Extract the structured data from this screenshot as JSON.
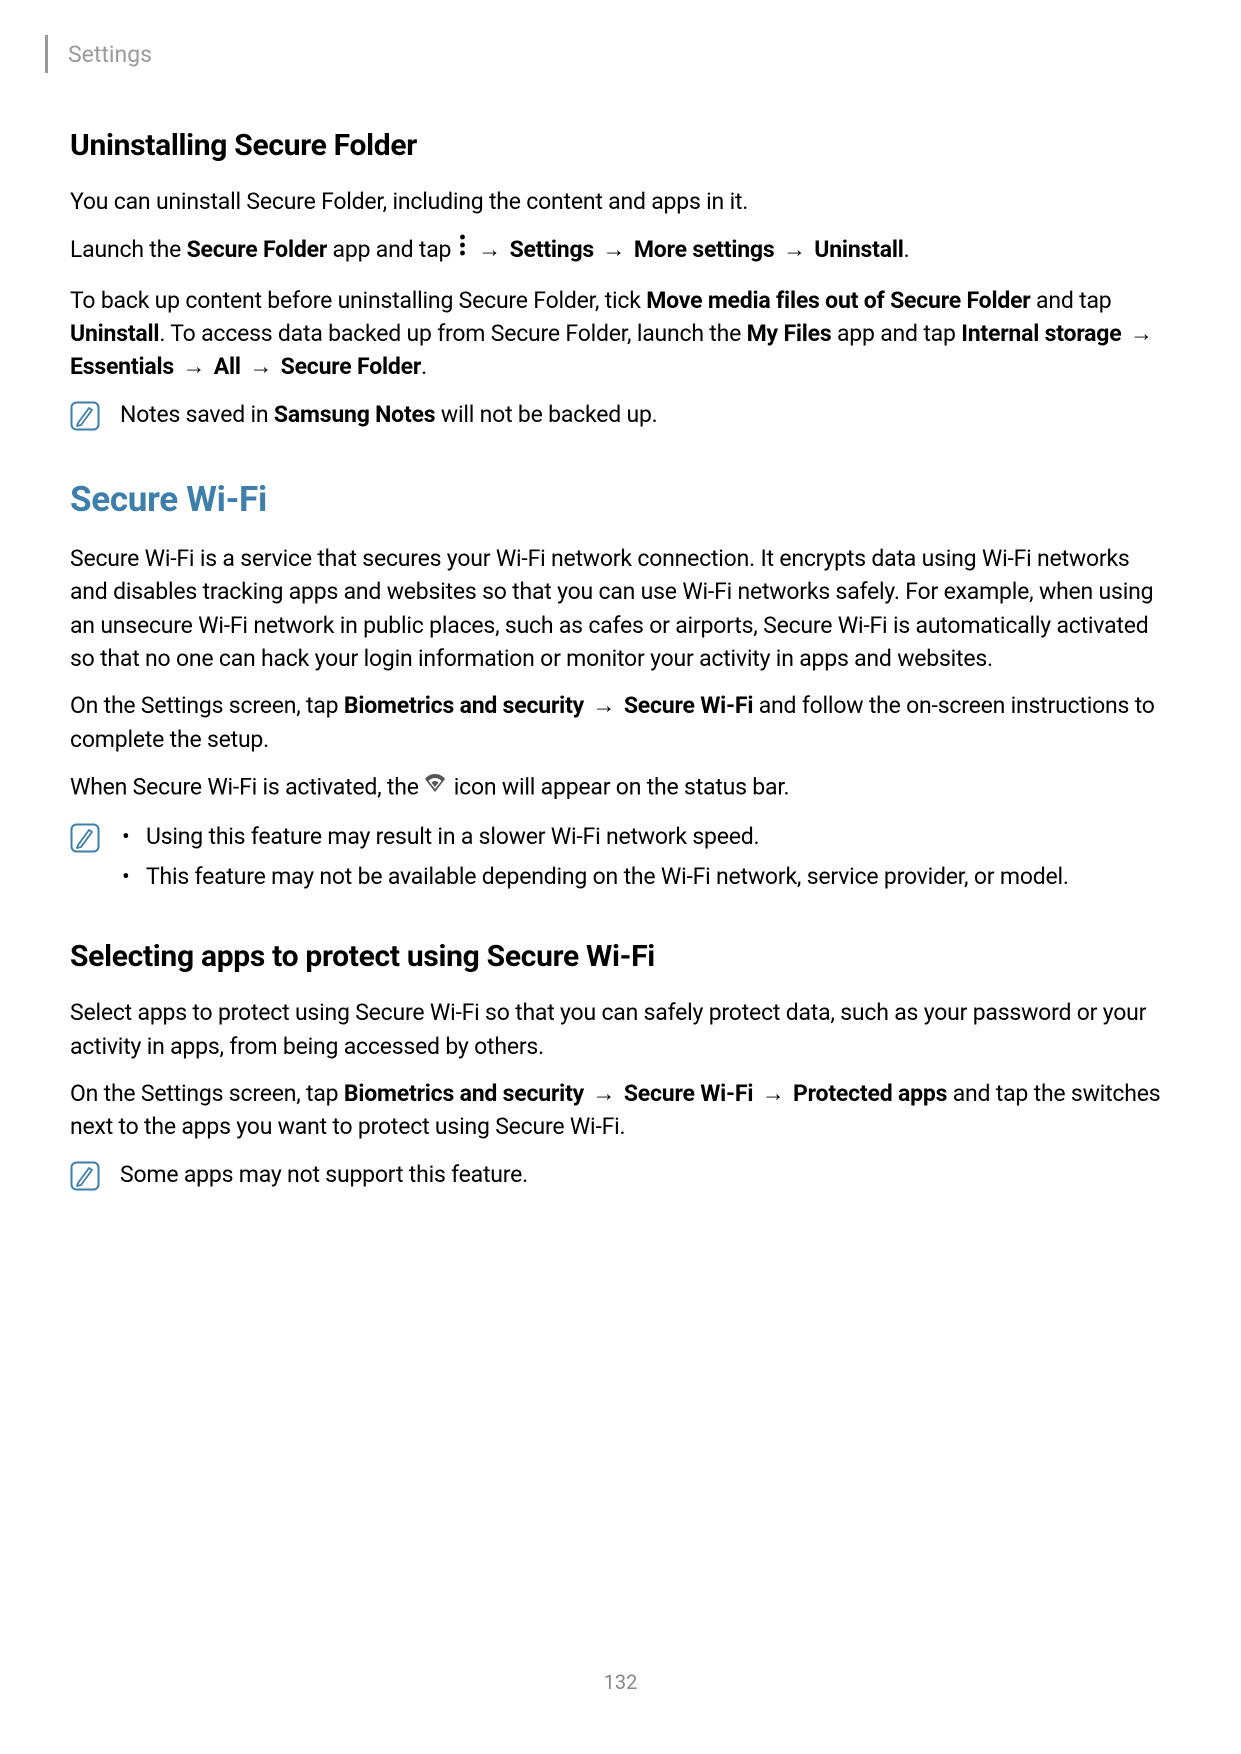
{
  "header": {
    "title": "Settings"
  },
  "pageNumber": "132",
  "uninstall": {
    "heading": "Uninstalling Secure Folder",
    "p1": "You can uninstall Secure Folder, including the content and apps in it.",
    "p2a": "Launch the ",
    "p2b": "Secure Folder",
    "p2c": " app and tap ",
    "p2d": " → ",
    "p2e": "Settings",
    "p2f": " → ",
    "p2g": "More settings",
    "p2h": " → ",
    "p2i": "Uninstall",
    "p2j": ".",
    "p3a": "To back up content before uninstalling Secure Folder, tick ",
    "p3b": "Move media files out of Secure Folder",
    "p3c": " and tap ",
    "p3d": "Uninstall",
    "p3e": ". To access data backed up from Secure Folder, launch the ",
    "p3f": "My Files",
    "p3g": " app and tap ",
    "p3h": "Internal storage",
    "p3i": " → ",
    "p3j": "Essentials",
    "p3k": " → ",
    "p3l": "All",
    "p3m": " → ",
    "p3n": "Secure Folder",
    "p3o": ".",
    "note_a": "Notes saved in ",
    "note_b": "Samsung Notes",
    "note_c": " will not be backed up."
  },
  "secureWifi": {
    "heading": "Secure Wi-Fi",
    "p1": "Secure Wi-Fi is a service that secures your Wi-Fi network connection. It encrypts data using Wi-Fi networks and disables tracking apps and websites so that you can use Wi-Fi networks safely. For example, when using an unsecure Wi-Fi network in public places, such as cafes or airports, Secure Wi-Fi is automatically activated so that no one can hack your login information or monitor your activity in apps and websites.",
    "p2a": "On the Settings screen, tap ",
    "p2b": "Biometrics and security",
    "p2c": " → ",
    "p2d": "Secure Wi-Fi",
    "p2e": " and follow the on-screen instructions to complete the setup.",
    "p3a": "When Secure Wi-Fi is activated, the ",
    "p3b": " icon will appear on the status bar.",
    "bullet1": "Using this feature may result in a slower Wi-Fi network speed.",
    "bullet2": "This feature may not be available depending on the Wi-Fi network, service provider, or model."
  },
  "selecting": {
    "heading": "Selecting apps to protect using Secure Wi-Fi",
    "p1": "Select apps to protect using Secure Wi-Fi so that you can safely protect data, such as your password or your activity in apps, from being accessed by others.",
    "p2a": "On the Settings screen, tap ",
    "p2b": "Biometrics and security",
    "p2c": " → ",
    "p2d": "Secure Wi-Fi",
    "p2e": " → ",
    "p2f": "Protected apps",
    "p2g": " and tap the switches next to the apps you want to protect using Secure Wi-Fi.",
    "note": "Some apps may not support this feature."
  }
}
